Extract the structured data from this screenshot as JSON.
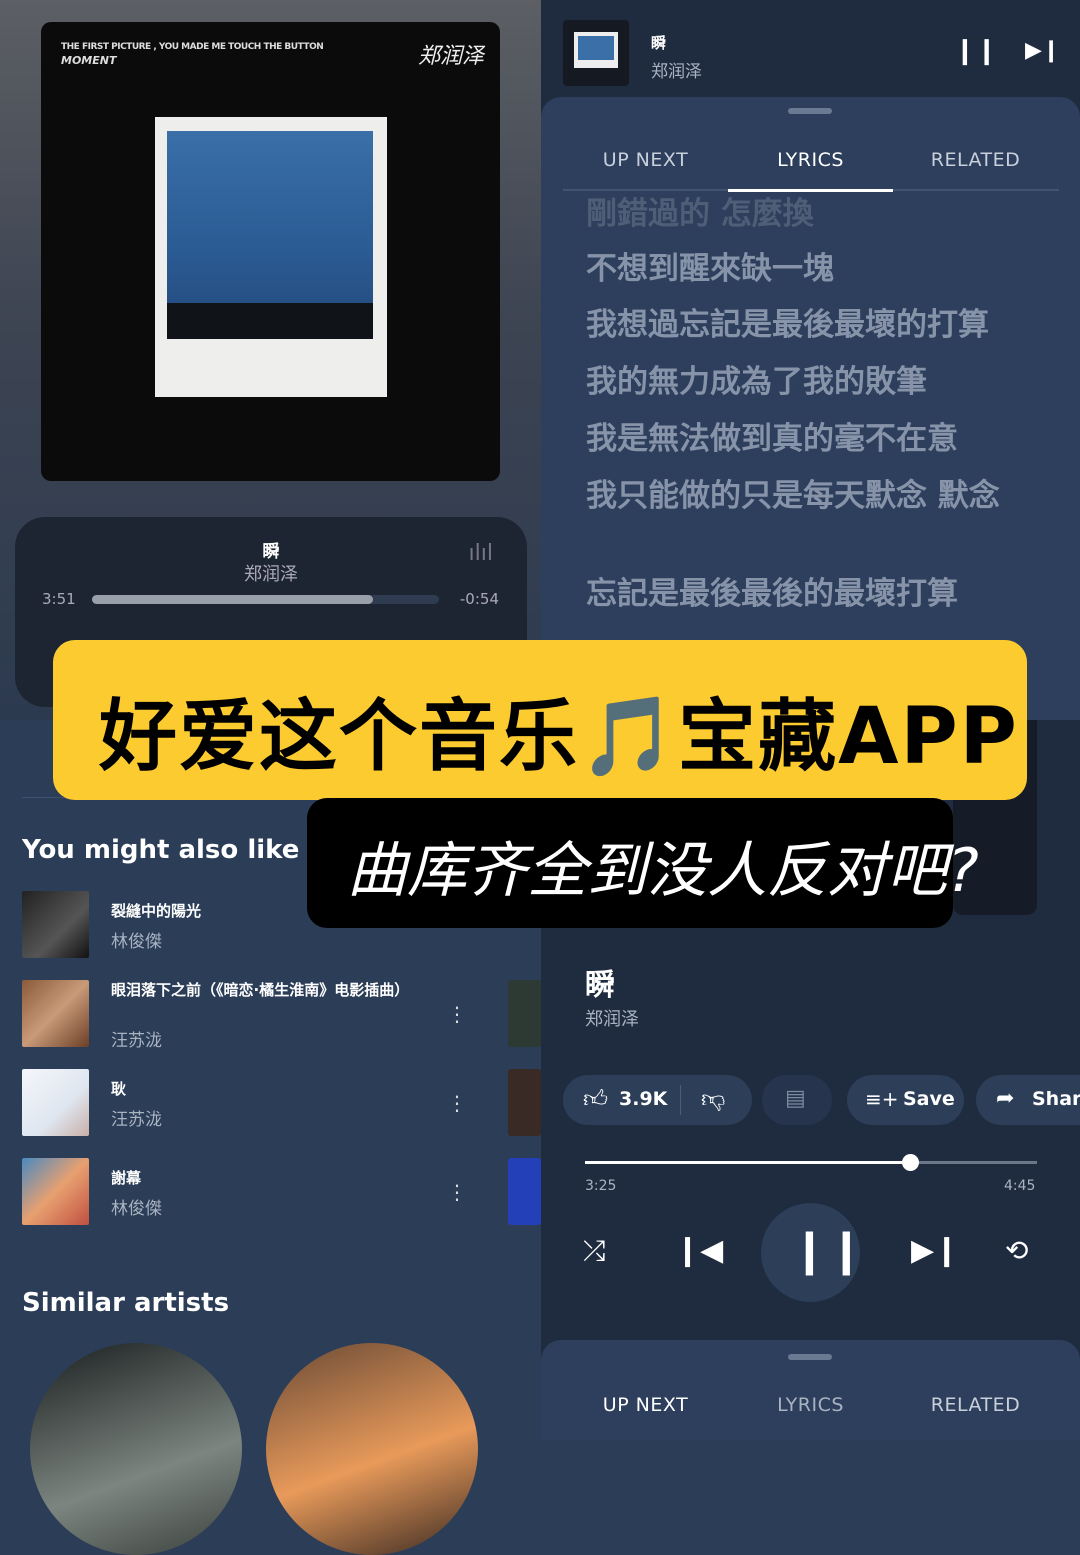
{
  "album": {
    "line1": "THE FIRST PICTURE , YOU MADE ME TOUCH THE BUTTON",
    "line2": "MOMENT",
    "signature": "郑润泽"
  },
  "mini_player": {
    "title": "瞬",
    "artist": "郑润泽",
    "elapsed": "3:51",
    "remaining": "-0:54",
    "progress_percent": 81,
    "icon": "waveform-icon"
  },
  "recommendations": {
    "heading": "You might also like",
    "items": [
      {
        "title": "裂縫中的陽光",
        "artist": "林俊傑"
      },
      {
        "title": "眼泪落下之前（《暗恋·橘生淮南》电影插曲）",
        "artist": "汪苏泷"
      },
      {
        "title": "耿",
        "artist": "汪苏泷"
      },
      {
        "title": "謝幕",
        "artist": "林俊傑"
      }
    ]
  },
  "similar_artists": {
    "heading": "Similar artists"
  },
  "now_playing_bar": {
    "title": "瞬",
    "artist": "郑润泽"
  },
  "tabs": [
    "UP NEXT",
    "LYRICS",
    "RELATED"
  ],
  "active_tab": "LYRICS",
  "lyrics": [
    "剛錯過的 怎麼換",
    "不想到醒來缺一塊",
    "我想過忘記是最後最壞的打算",
    "我的無力成為了我的敗筆",
    "我是無法做到真的毫不在意",
    "我只能做的只是每天默念 默念",
    "忘記是最後最後的最壞打算"
  ],
  "player": {
    "title": "瞬",
    "artist": "郑润泽",
    "likes": "3.9K",
    "save_label": "Save",
    "share_label": "Share",
    "elapsed": "3:25",
    "duration": "4:45",
    "progress_percent": 72
  },
  "banner": {
    "headline": "好爱这个音乐🎵宝藏APP",
    "subline": "曲库齐全到没人反对吧?"
  },
  "colors": {
    "banner": "#fccb30",
    "background": "#2b3d57",
    "panel": "#1f2b3f"
  }
}
